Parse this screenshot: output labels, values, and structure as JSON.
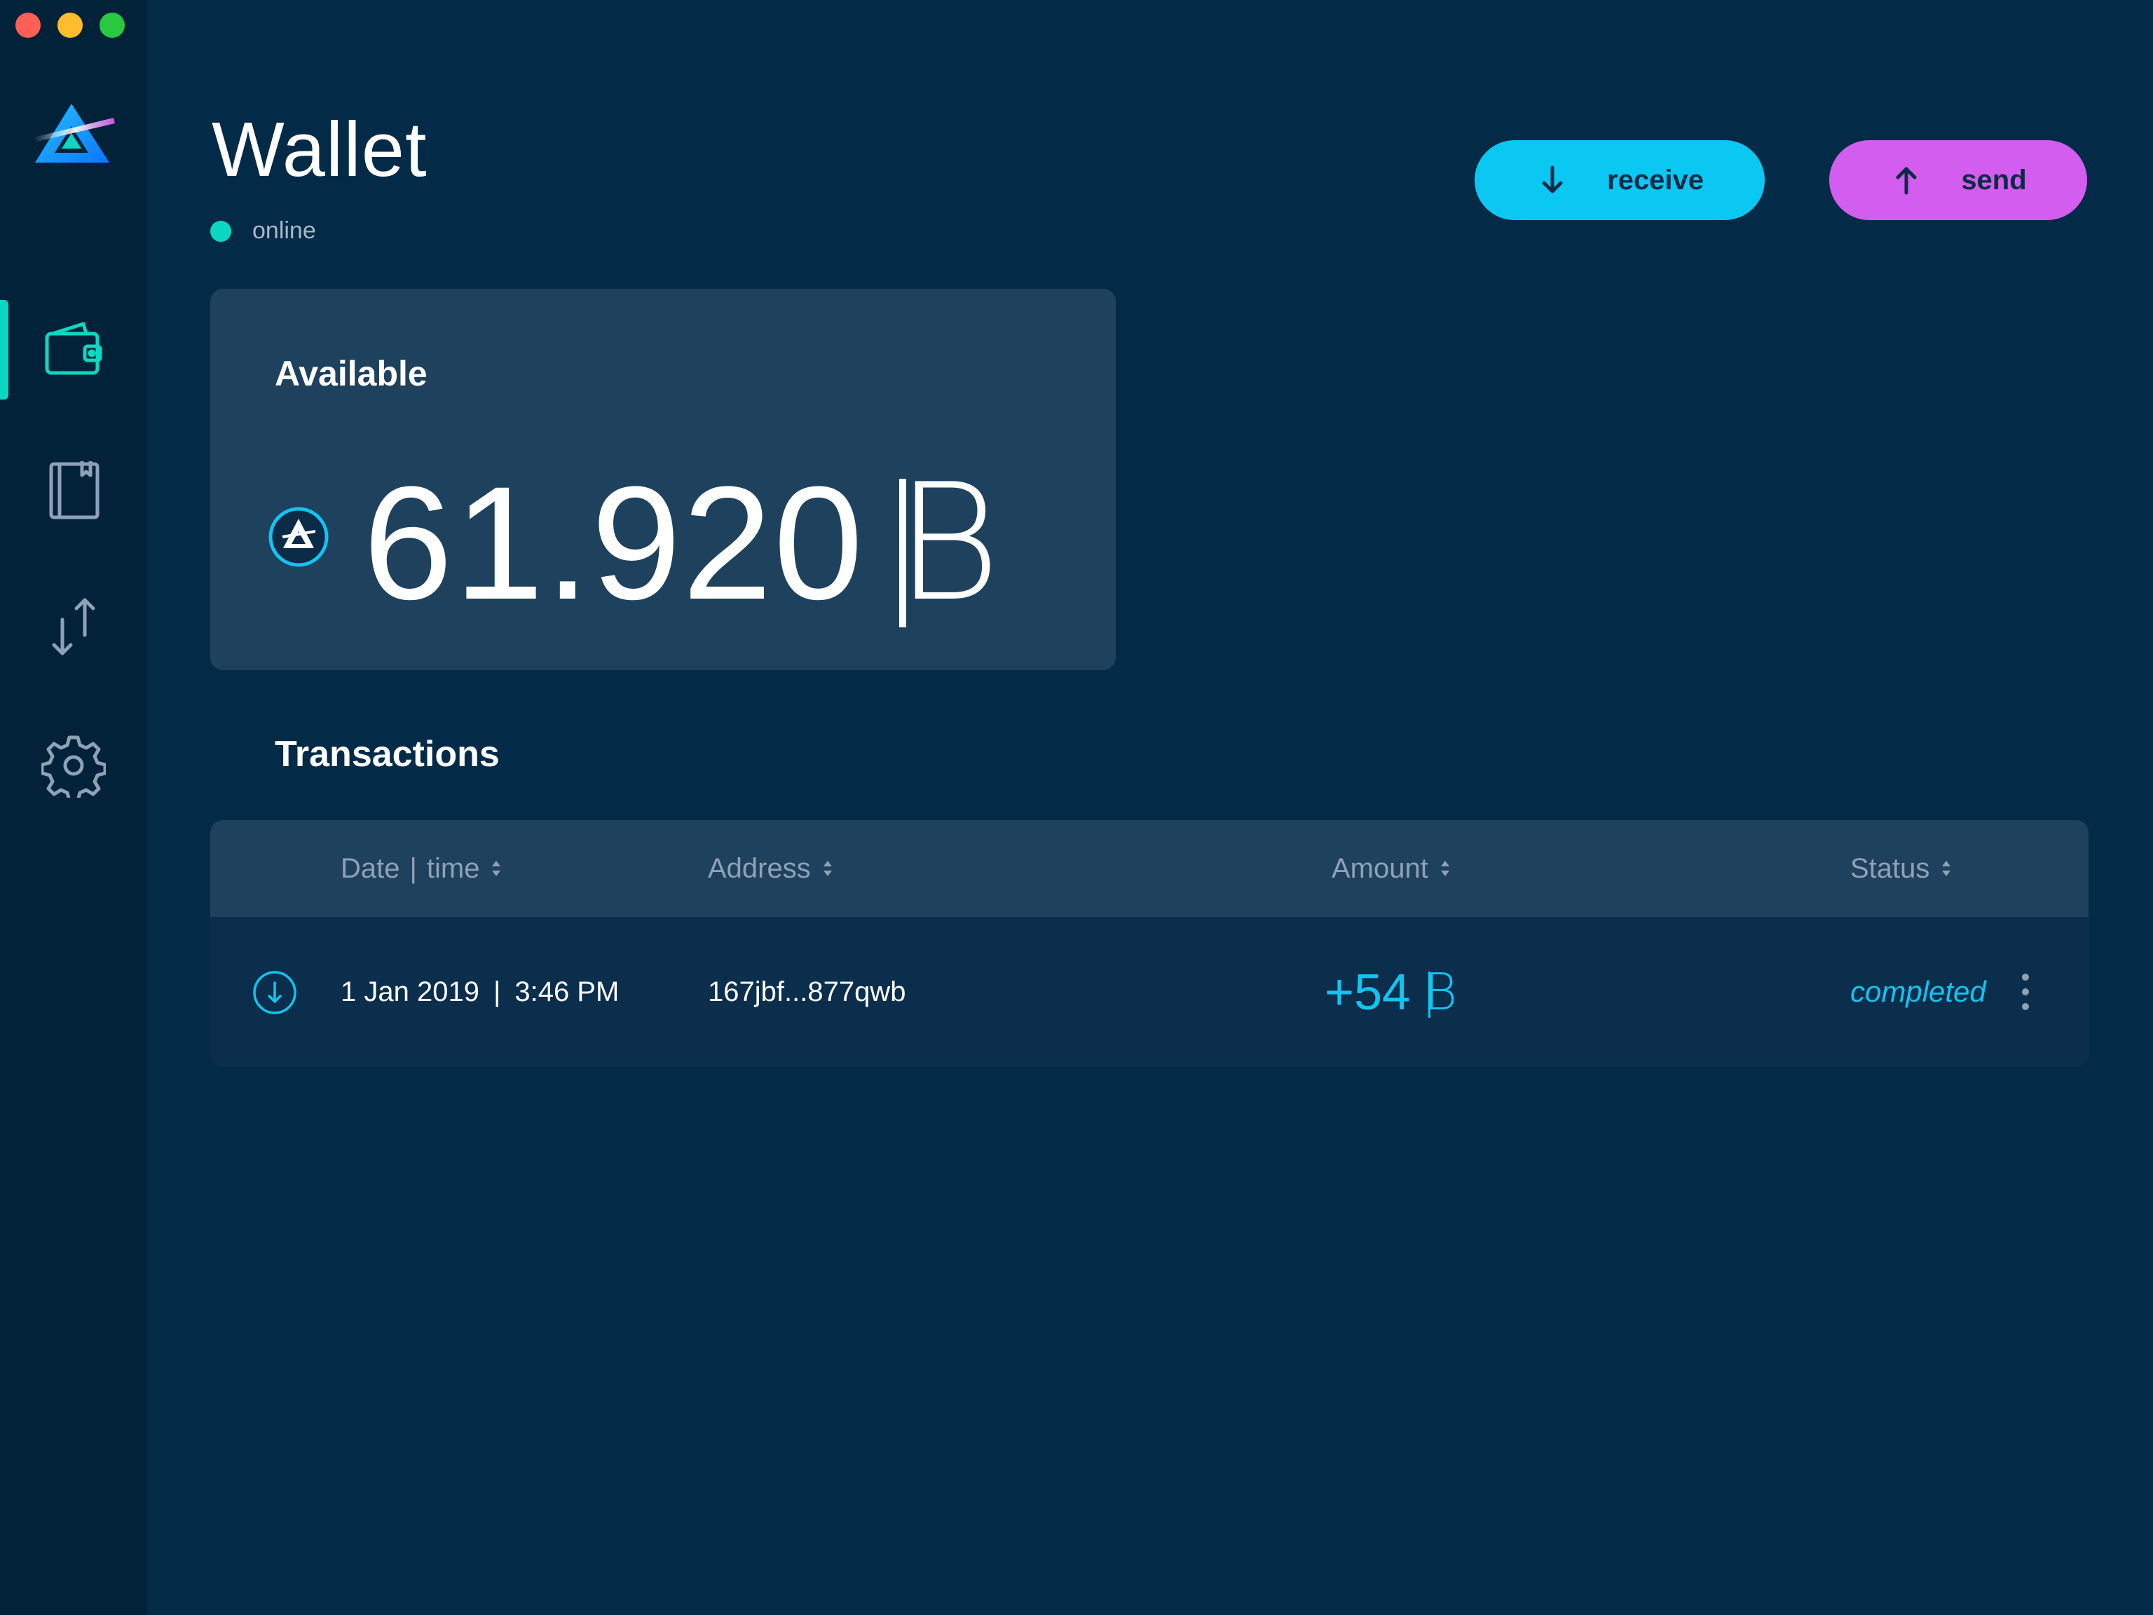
{
  "app": {
    "title": "Wallet",
    "connection_status": "online"
  },
  "colors": {
    "background": "#032b47",
    "sidebar": "#02223a",
    "card": "#1e415d",
    "accent_teal": "#0bd8c1",
    "receive_button": "#0bc8f2",
    "send_button": "#d35dee",
    "amount_positive": "#14c3ef"
  },
  "sidebar": {
    "items": [
      {
        "name": "wallet",
        "icon": "wallet-icon",
        "active": true
      },
      {
        "name": "address-book",
        "icon": "notebook-icon",
        "active": false
      },
      {
        "name": "utxo",
        "icon": "transfer-arrows-icon",
        "active": false
      },
      {
        "name": "settings",
        "icon": "gear-icon",
        "active": false
      }
    ]
  },
  "actions": {
    "receive_label": "receive",
    "send_label": "send"
  },
  "balance": {
    "label": "Available",
    "amount": "61.920",
    "currency_symbol": "B"
  },
  "transactions": {
    "title": "Transactions",
    "columns": [
      "Date",
      "time",
      "Address",
      "Amount",
      "Status"
    ],
    "rows": [
      {
        "direction": "incoming",
        "date": "1 Jan 2019",
        "time": "3:46 PM",
        "address": "167jbf...877qwb",
        "amount": "+54",
        "currency_symbol": "B",
        "status": "completed"
      }
    ]
  }
}
